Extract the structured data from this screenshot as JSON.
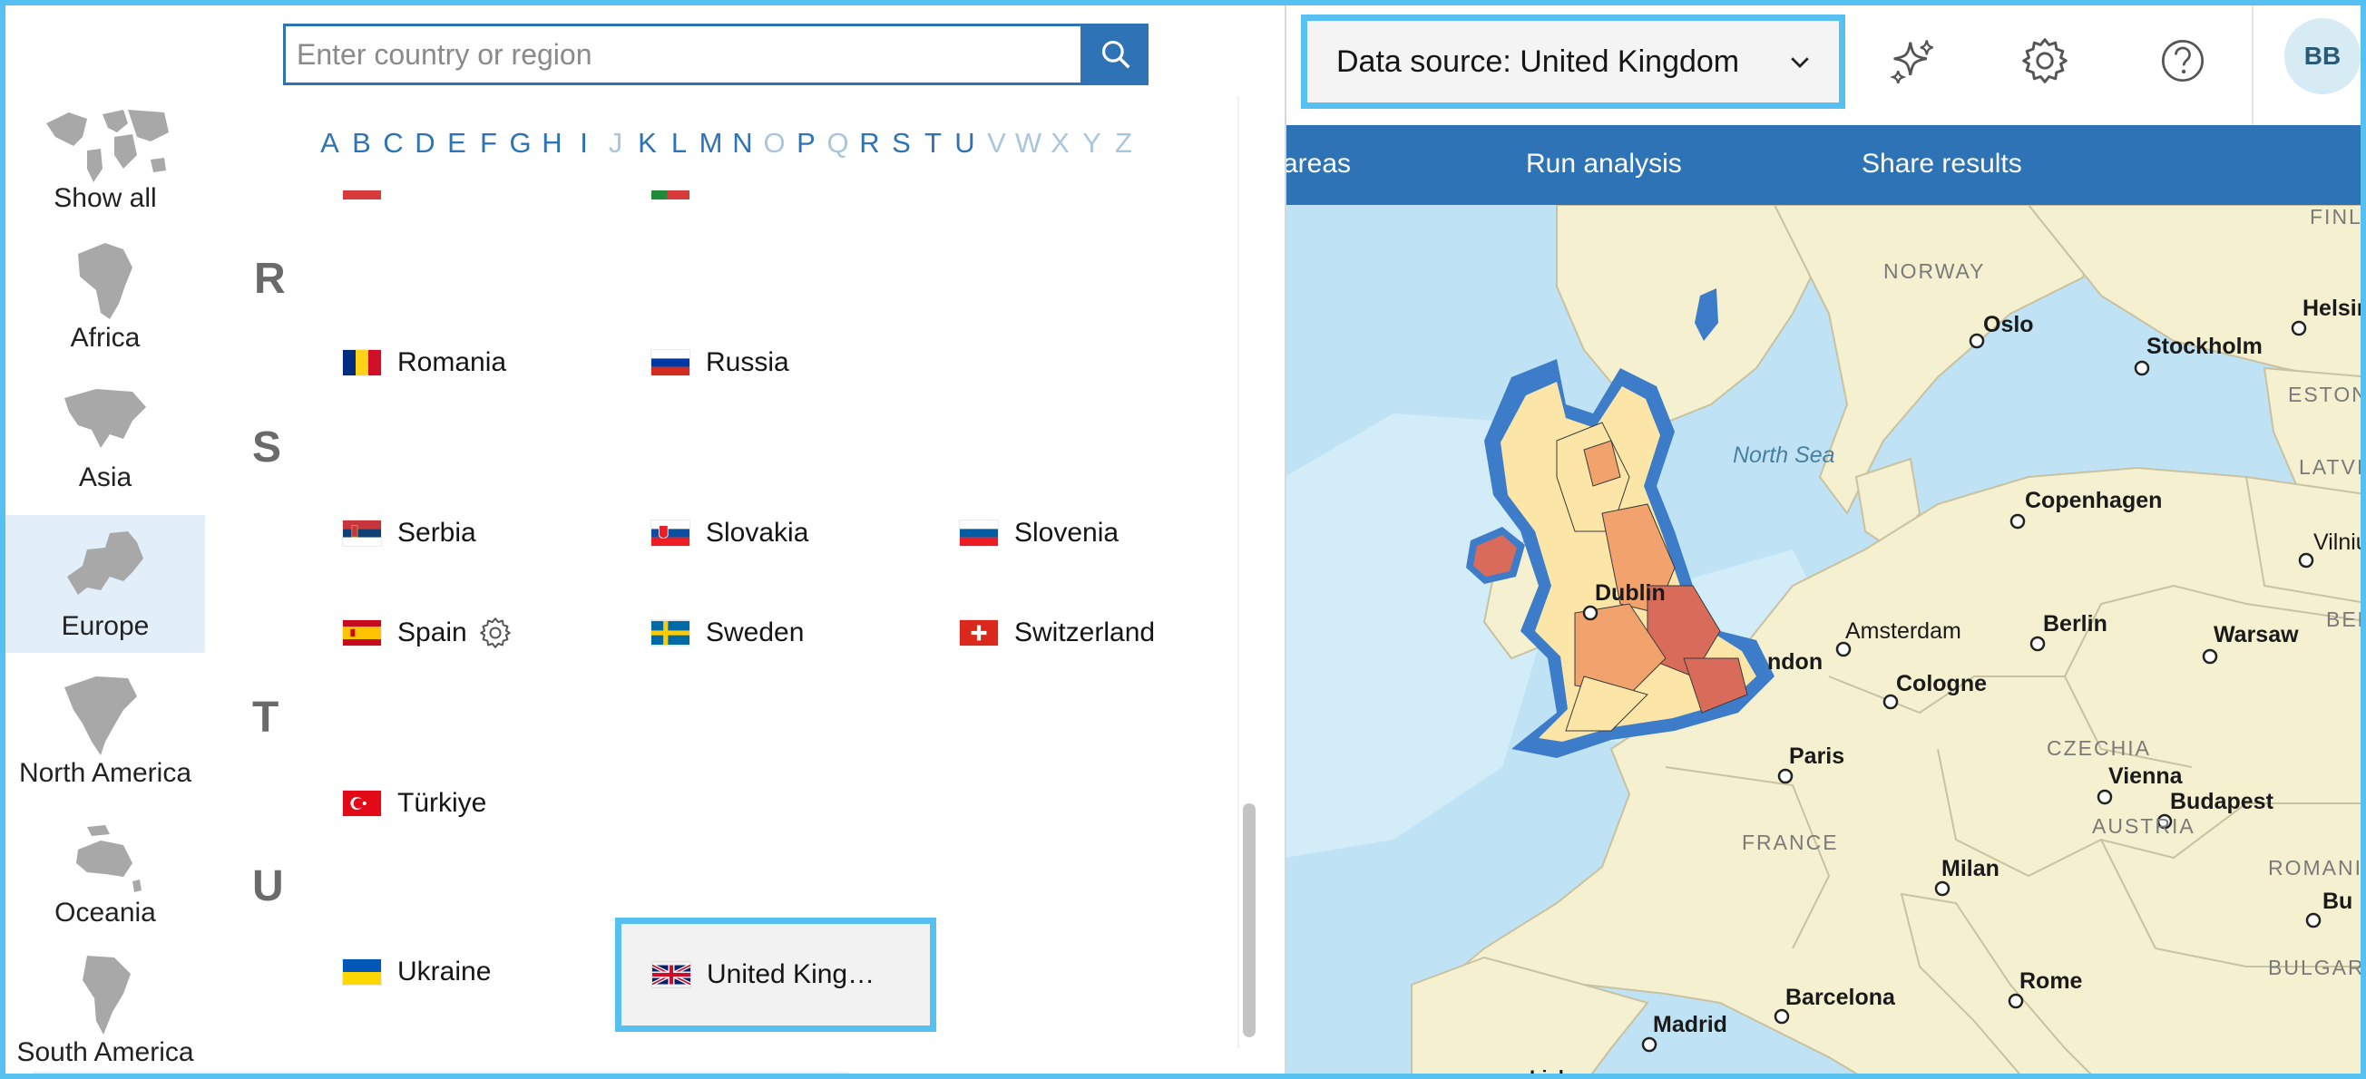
{
  "search": {
    "placeholder": "Enter country or region",
    "value": ""
  },
  "alphabet": {
    "letters": [
      "A",
      "B",
      "C",
      "D",
      "E",
      "F",
      "G",
      "H",
      "I",
      "J",
      "K",
      "L",
      "M",
      "N",
      "O",
      "P",
      "Q",
      "R",
      "S",
      "T",
      "U",
      "V",
      "W",
      "X",
      "Y",
      "Z"
    ],
    "disabled": [
      "J",
      "O",
      "Q",
      "V",
      "W",
      "X",
      "Y",
      "Z"
    ]
  },
  "regions": [
    {
      "label": "Show all",
      "icon": "world-map-icon"
    },
    {
      "label": "Africa",
      "icon": "africa-map-icon"
    },
    {
      "label": "Asia",
      "icon": "asia-map-icon"
    },
    {
      "label": "Europe",
      "icon": "europe-map-icon",
      "selected": true
    },
    {
      "label": "North America",
      "icon": "north-america-map-icon"
    },
    {
      "label": "Oceania",
      "icon": "oceania-map-icon"
    },
    {
      "label": "South America",
      "icon": "south-america-map-icon"
    }
  ],
  "sections": [
    {
      "letter": "R",
      "countries": [
        {
          "name": "Romania"
        },
        {
          "name": "Russia"
        }
      ]
    },
    {
      "letter": "S",
      "countries": [
        {
          "name": "Serbia"
        },
        {
          "name": "Slovakia"
        },
        {
          "name": "Slovenia"
        },
        {
          "name": "Spain",
          "has_settings": true
        },
        {
          "name": "Sweden"
        },
        {
          "name": "Switzerland"
        }
      ]
    },
    {
      "letter": "T",
      "countries": [
        {
          "name": "Türkiye"
        }
      ]
    },
    {
      "letter": "U",
      "countries": [
        {
          "name": "Ukraine"
        },
        {
          "name": "United King…",
          "selected": true
        }
      ]
    }
  ],
  "header": {
    "data_source_label": "Data source: United Kingdom",
    "avatar_initials": "BB",
    "icons": [
      "sparkle-icon",
      "gear-icon",
      "help-icon"
    ]
  },
  "nav": {
    "items": [
      "areas",
      "Run analysis",
      "Share results"
    ]
  },
  "map": {
    "cities": [
      "Oslo",
      "Stockholm",
      "Helsin",
      "Copenhagen",
      "Dublin",
      "ndon",
      "Amsterdam",
      "Berlin",
      "Warsaw",
      "Vilniu",
      "Cologne",
      "Paris",
      "Vienna",
      "Budapest",
      "Milan",
      "Barcelona",
      "Rome",
      "Madrid",
      "Bu",
      "Lisbon"
    ],
    "regions": [
      "NORWAY",
      "ESTONIA",
      "LATVIA",
      "BELA",
      "CZECHIA",
      "AUSTRIA",
      "FRANCE",
      "ROMANIA",
      "BULGARIA",
      "FINLA"
    ],
    "seas": [
      "North Sea"
    ]
  },
  "colors": {
    "accent": "#2d73b5",
    "highlight": "#56c1f0",
    "land": "#f5f0d0",
    "water": "#bfe3f5",
    "uk_outline": "#3d7cc9",
    "uk_fill_light": "#fbe6a8",
    "uk_fill_mid": "#f2a36d",
    "uk_fill_dark": "#d96b5b"
  }
}
